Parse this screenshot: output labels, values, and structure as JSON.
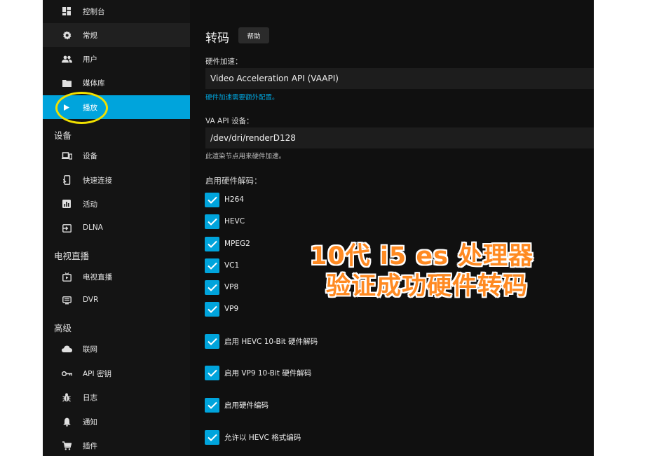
{
  "sidebar": {
    "items": [
      {
        "label": "控制台",
        "icon": "dashboard-icon"
      },
      {
        "label": "常规",
        "icon": "gear-icon"
      },
      {
        "label": "用户",
        "icon": "users-icon"
      },
      {
        "label": "媒体库",
        "icon": "folder-icon"
      },
      {
        "label": "播放",
        "icon": "play-icon"
      }
    ],
    "devices_header": "设备",
    "devices": [
      {
        "label": "设备",
        "icon": "devices-icon"
      },
      {
        "label": "快速连接",
        "icon": "phone-link-icon"
      },
      {
        "label": "活动",
        "icon": "activity-icon"
      },
      {
        "label": "DLNA",
        "icon": "input-icon"
      }
    ],
    "livetv_header": "电视直播",
    "livetv": [
      {
        "label": "电视直播",
        "icon": "tv-icon"
      },
      {
        "label": "DVR",
        "icon": "dvr-icon"
      }
    ],
    "advanced_header": "高级",
    "advanced": [
      {
        "label": "联网",
        "icon": "cloud-icon"
      },
      {
        "label": "API 密钥",
        "icon": "key-icon"
      },
      {
        "label": "日志",
        "icon": "bug-icon"
      },
      {
        "label": "通知",
        "icon": "bell-icon"
      },
      {
        "label": "插件",
        "icon": "cart-icon"
      }
    ]
  },
  "main": {
    "title": "转码",
    "help_label": "帮助",
    "hw_accel_label": "硬件加速：",
    "hw_accel_value": "Video Acceleration API (VAAPI)",
    "hw_accel_hint": "硬件加速需要额外配置。",
    "vaapi_device_label": "VA API 设备：",
    "vaapi_device_value": "/dev/dri/renderD128",
    "vaapi_device_hint": "此渲染节点用来硬件加速。",
    "hw_decode_label": "启用硬件解码：",
    "codecs": [
      {
        "label": "H264",
        "checked": true
      },
      {
        "label": "HEVC",
        "checked": true
      },
      {
        "label": "MPEG2",
        "checked": true
      },
      {
        "label": "VC1",
        "checked": true
      },
      {
        "label": "VP8",
        "checked": true
      },
      {
        "label": "VP9",
        "checked": true
      }
    ],
    "options": [
      {
        "label": "启用 HEVC 10-Bit 硬件解码",
        "checked": true
      },
      {
        "label": "启用 VP9 10-Bit 硬件解码",
        "checked": true
      },
      {
        "label": "启用硬件编码",
        "checked": true
      },
      {
        "label": "允许以 HEVC 格式编码",
        "checked": true
      }
    ]
  },
  "overlay": {
    "line1": "10代 i5 es 处理器",
    "line2": "验证成功硬件转码"
  },
  "colors": {
    "accent": "#00a4dc",
    "overlay_text": "#ff8a22",
    "highlight_circle": "#f0e000"
  }
}
